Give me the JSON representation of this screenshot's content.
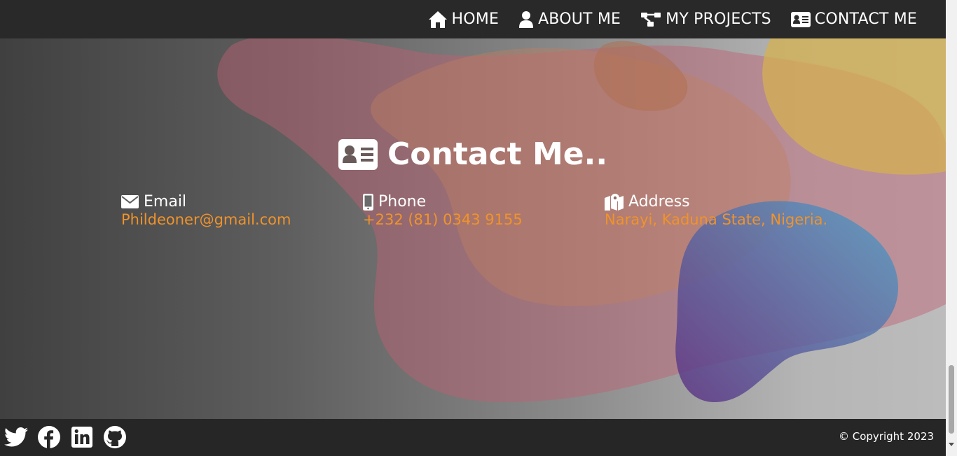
{
  "nav": {
    "items": [
      {
        "label": "HOME",
        "icon": "home-icon"
      },
      {
        "label": "ABOUT ME",
        "icon": "user-icon"
      },
      {
        "label": "MY PROJECTS",
        "icon": "sitemap-icon"
      },
      {
        "label": "CONTACT ME",
        "icon": "address-card-icon"
      }
    ]
  },
  "contact": {
    "title": "Contact Me..",
    "email": {
      "label": "Email",
      "value": "Phildeoner@gmail.com",
      "icon": "envelope-icon"
    },
    "phone": {
      "label": "Phone",
      "value": "+232 (81) 0343 9155",
      "icon": "mobile-icon"
    },
    "address": {
      "label": "Address",
      "value": "Narayi, Kaduna State, Nigeria.",
      "icon": "map-marker-icon"
    }
  },
  "footer": {
    "socials": [
      "twitter-icon",
      "facebook-icon",
      "linkedin-icon",
      "github-icon"
    ],
    "copyright": "© Copyright 2023"
  },
  "colors": {
    "accent": "#f0932b",
    "nav_bg": "#292929",
    "footer_bg": "#262626"
  }
}
